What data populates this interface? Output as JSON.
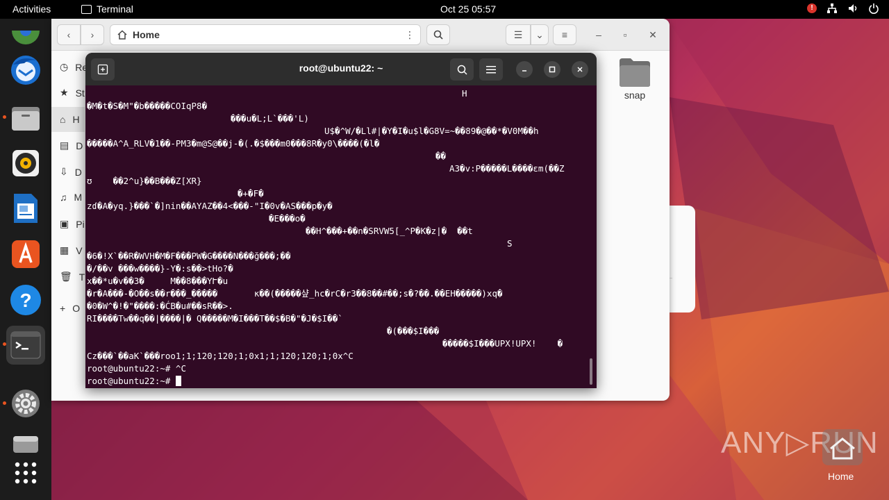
{
  "topbar": {
    "activities": "Activities",
    "app_name": "Terminal",
    "clock": "Oct 25  05:57"
  },
  "files": {
    "location": "Home",
    "sidebar": [
      {
        "icon": "recent-icon",
        "label": "Re"
      },
      {
        "icon": "star-icon",
        "label": "St"
      },
      {
        "icon": "home-icon",
        "label": "H"
      },
      {
        "icon": "document-icon",
        "label": "D"
      },
      {
        "icon": "download-icon",
        "label": "D"
      },
      {
        "icon": "music-icon",
        "label": "M"
      },
      {
        "icon": "picture-icon",
        "label": "Pi"
      },
      {
        "icon": "video-icon",
        "label": "V"
      },
      {
        "icon": "trash-icon",
        "label": "T"
      },
      {
        "icon": "plus-icon",
        "label": "O"
      }
    ],
    "folder": "snap"
  },
  "terminal": {
    "title": "root@ubuntu22: ~",
    "lines": [
      {
        "indent": 540,
        "text": "H"
      },
      {
        "indent": 0,
        "text": "�M�t�S�M\"�b�����COIqP8�"
      },
      {
        "indent": 207,
        "text": "���u�L;L`���'L)"
      },
      {
        "indent": 342,
        "text": "U$�^W/�Ll#|�Y�I�u$l�G8V=~��89�@��*�V0M��h"
      },
      {
        "indent": 0,
        "text": "�����A^A_RLV�1��-PM3�m@S@��j-�(.�$���m0���8R�y0\\����(�l�"
      },
      {
        "indent": 502,
        "text": "��"
      },
      {
        "indent": 522,
        "text": "A3�v:P�����L����ɛm(��Z"
      },
      {
        "indent": 0,
        "text": "ʊ    ��2^u}��B���Z[XR}"
      },
      {
        "indent": 217,
        "text": "�+�F�"
      },
      {
        "indent": 0,
        "text": "zɗ�A�yq.}���`�]nin��AYAZ��4<���-\"I�0v�AS���p�y�"
      },
      {
        "indent": 262,
        "text": "�E���o�"
      },
      {
        "indent": 315,
        "text": "��H^���+��n�SRVW5[_^P�K�z|�  ��t"
      },
      {
        "indent": 605,
        "text": "S"
      },
      {
        "indent": 0,
        "text": "�6�!X`��R�WVH�M�F���PW�G����N���ğ���;��"
      },
      {
        "indent": 0,
        "text": "�/��v ���w����}-Y�:s��>tHo?�"
      },
      {
        "indent": 0,
        "text": "x��*u�v��3�     M��8���YՒ�u"
      },
      {
        "indent": 0,
        "text": "�r�A���-�O��s��r���_�����       κ��(�����샾_hc�rC�r3��8��#��;s�?��.��EH�����)xq�"
      },
      {
        "indent": 0,
        "text": "�0�W^�!�\"����:�ĆB�u#��sR��>."
      },
      {
        "indent": 0,
        "text": "RI����Tw��q��|����|� Q�����M�I���T��$�B�\"�J�$I��`"
      },
      {
        "indent": 432,
        "text": "�(���$I���"
      },
      {
        "indent": 512,
        "text": "�����$I���UPX!UPX!    �"
      },
      {
        "indent": 0,
        "text": "Cz���`��aK`���roo1;1;120;120;1;0x1;1;120;120;1;0x^C"
      },
      {
        "indent": 0,
        "text": "root@ubuntu22:~# ^C"
      }
    ],
    "prompt": "root@ubuntu22:~# "
  },
  "desktop": {
    "watermark": "ANY▷RUN",
    "home_label": "Home"
  }
}
